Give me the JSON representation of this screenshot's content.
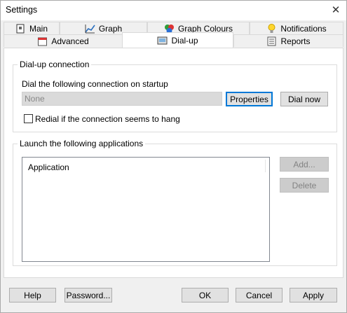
{
  "window": {
    "title": "Settings"
  },
  "tabs": {
    "row1": [
      {
        "label": "Main",
        "icon": "book-icon"
      },
      {
        "label": "Graph",
        "icon": "graph-icon"
      },
      {
        "label": "Graph Colours",
        "icon": "colour-balls-icon"
      },
      {
        "label": "Notifications",
        "icon": "lightbulb-icon"
      }
    ],
    "row2": [
      {
        "label": "Advanced",
        "icon": "calendar-icon"
      },
      {
        "label": "Dial-up",
        "icon": "dialup-icon",
        "active": true
      },
      {
        "label": "Reports",
        "icon": "reports-icon"
      }
    ]
  },
  "dialup": {
    "group_label": "Dial-up connection",
    "prompt": "Dial the following connection on startup",
    "connection_value": "None",
    "properties_button": "Properties",
    "dial_now_button": "Dial now",
    "redial_label": "Redial if the connection seems to hang",
    "redial_checked": false
  },
  "launch": {
    "group_label": "Launch the following applications",
    "column_header": "Application",
    "add_button": "Add...",
    "delete_button": "Delete"
  },
  "footer": {
    "help": "Help",
    "password": "Password...",
    "ok": "OK",
    "cancel": "Cancel",
    "apply": "Apply"
  }
}
